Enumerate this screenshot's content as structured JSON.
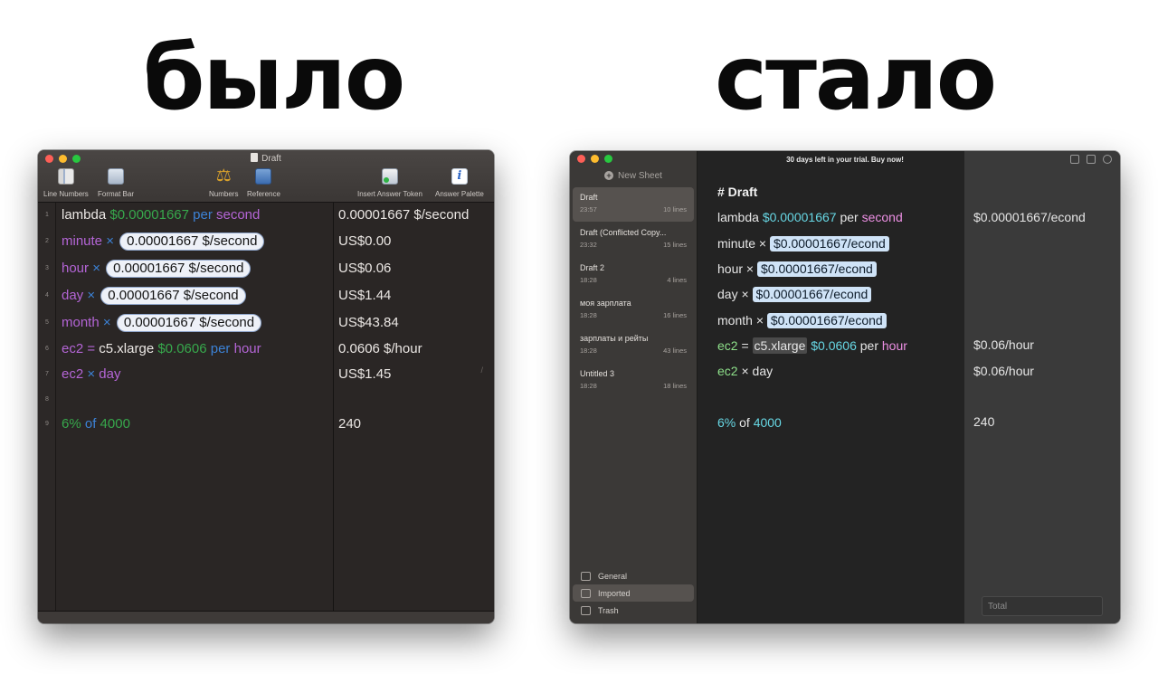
{
  "headings": {
    "before": "было",
    "after": "стало"
  },
  "old_app": {
    "title": "Draft",
    "toolbar": {
      "line_numbers": "Line Numbers",
      "format_bar": "Format Bar",
      "numbers": "Numbers",
      "reference": "Reference",
      "insert_answer_token": "Insert Answer Token",
      "answer_palette": "Answer Palette"
    },
    "line_numbers": [
      "1",
      "2",
      "3",
      "4",
      "5",
      "6",
      "7",
      "8",
      "9"
    ],
    "lines": [
      {
        "a": "lambda",
        "b": "$0.00001667",
        "c": "per",
        "d": "second"
      },
      {
        "a": "minute",
        "op": "×",
        "token": "0.00001667 $/second"
      },
      {
        "a": "hour",
        "op": "×",
        "token": "0.00001667 $/second"
      },
      {
        "a": "day",
        "op": "×",
        "token": "0.00001667 $/second"
      },
      {
        "a": "month",
        "op": "×",
        "token": "0.00001667 $/second"
      },
      {
        "a": "ec2",
        "eq": "=",
        "v": "c5.xlarge",
        "b": "$0.0606",
        "c": "per",
        "d": "hour"
      },
      {
        "a": "ec2",
        "op": "×",
        "d": "day"
      },
      {
        "a": "6%",
        "of": "of",
        "b": "4000"
      }
    ],
    "answers": [
      "0.00001667 $/second",
      "US$0.00",
      "US$0.06",
      "US$1.44",
      "US$43.84",
      "0.0606 $/hour",
      "US$1.45",
      "240"
    ],
    "scroll_mark": "/"
  },
  "new_app": {
    "trial_banner": "30 days left in your trial. Buy now!",
    "new_sheet": "New Sheet",
    "sheets": [
      {
        "title": "Draft",
        "time": "23:57",
        "lines": "10 lines"
      },
      {
        "title": "Draft (Conflicted Copy...",
        "time": "23:32",
        "lines": "15 lines"
      },
      {
        "title": "Draft 2",
        "time": "18:28",
        "lines": "4 lines"
      },
      {
        "title": "моя зарплата",
        "time": "18:28",
        "lines": "16 lines"
      },
      {
        "title": "зарплаты и рейты",
        "time": "18:28",
        "lines": "43 lines"
      },
      {
        "title": "Untitled 3",
        "time": "18:28",
        "lines": "18 lines"
      }
    ],
    "library": [
      "General",
      "Imported",
      "Trash"
    ],
    "doc_title": "# Draft",
    "lines": [
      {
        "a": "lambda",
        "b": "$0.00001667",
        "c": "per",
        "d": "second"
      },
      {
        "a": "minute",
        "op": "×",
        "token": "$0.00001667/econd"
      },
      {
        "a": "hour",
        "op": "×",
        "token": "$0.00001667/econd"
      },
      {
        "a": "day",
        "op": "×",
        "token": "$0.00001667/econd"
      },
      {
        "a": "month",
        "op": "×",
        "token": "$0.00001667/econd"
      },
      {
        "a": "ec2",
        "eq": "=",
        "v": "c5.xlarge",
        "b": "$0.0606",
        "c": "per",
        "d": "hour"
      },
      {
        "a": "ec2",
        "op": "×",
        "d": "day"
      },
      {
        "a": "6%",
        "of": "of",
        "b": "4000"
      }
    ],
    "answers": [
      "$0.00001667/econd",
      "$0.06/hour",
      "$0.06/hour",
      "240"
    ],
    "total_placeholder": "Total"
  }
}
